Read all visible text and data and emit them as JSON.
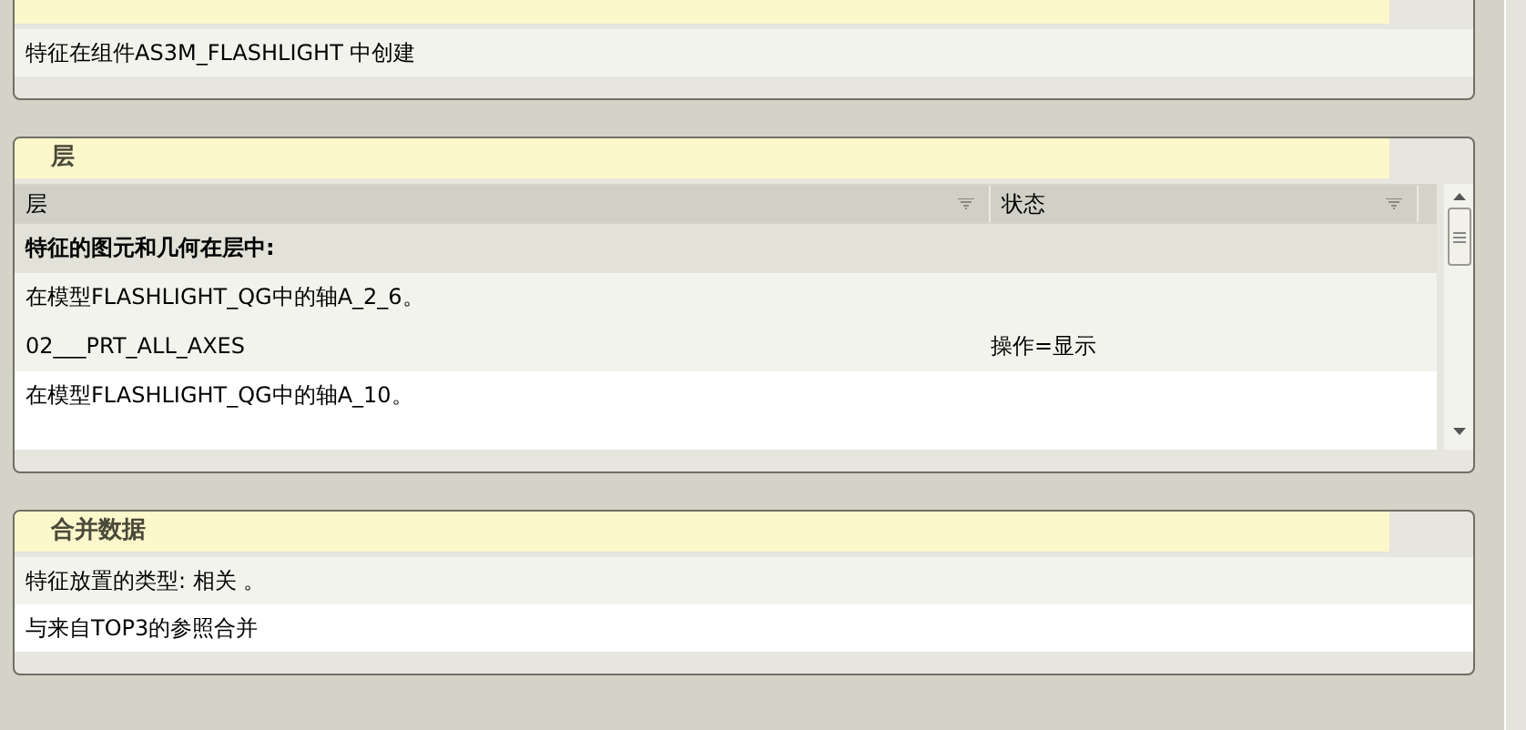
{
  "panels": [
    {
      "rows": [
        {
          "text": "特征在组件AS3M_FLASHLIGHT 中创建"
        }
      ]
    },
    {
      "title": "层",
      "table": {
        "columns": [
          "层",
          "状态"
        ],
        "rows": [
          {
            "kind": "group",
            "cells": [
              "特征的图元和几何在层中:"
            ]
          },
          {
            "kind": "item",
            "cells": [
              "在模型FLASHLIGHT_QG中的轴A_2_6。"
            ]
          },
          {
            "kind": "item",
            "cells": [
              "02___PRT_ALL_AXES",
              "操作=显示"
            ]
          },
          {
            "kind": "item",
            "cells": [
              "在模型FLASHLIGHT_QG中的轴A_10。"
            ]
          }
        ]
      }
    },
    {
      "title": "合并数据",
      "rows": [
        {
          "text": "特征放置的类型: 相关 。"
        },
        {
          "text": "与来自TOP3的参照合并"
        }
      ]
    }
  ]
}
